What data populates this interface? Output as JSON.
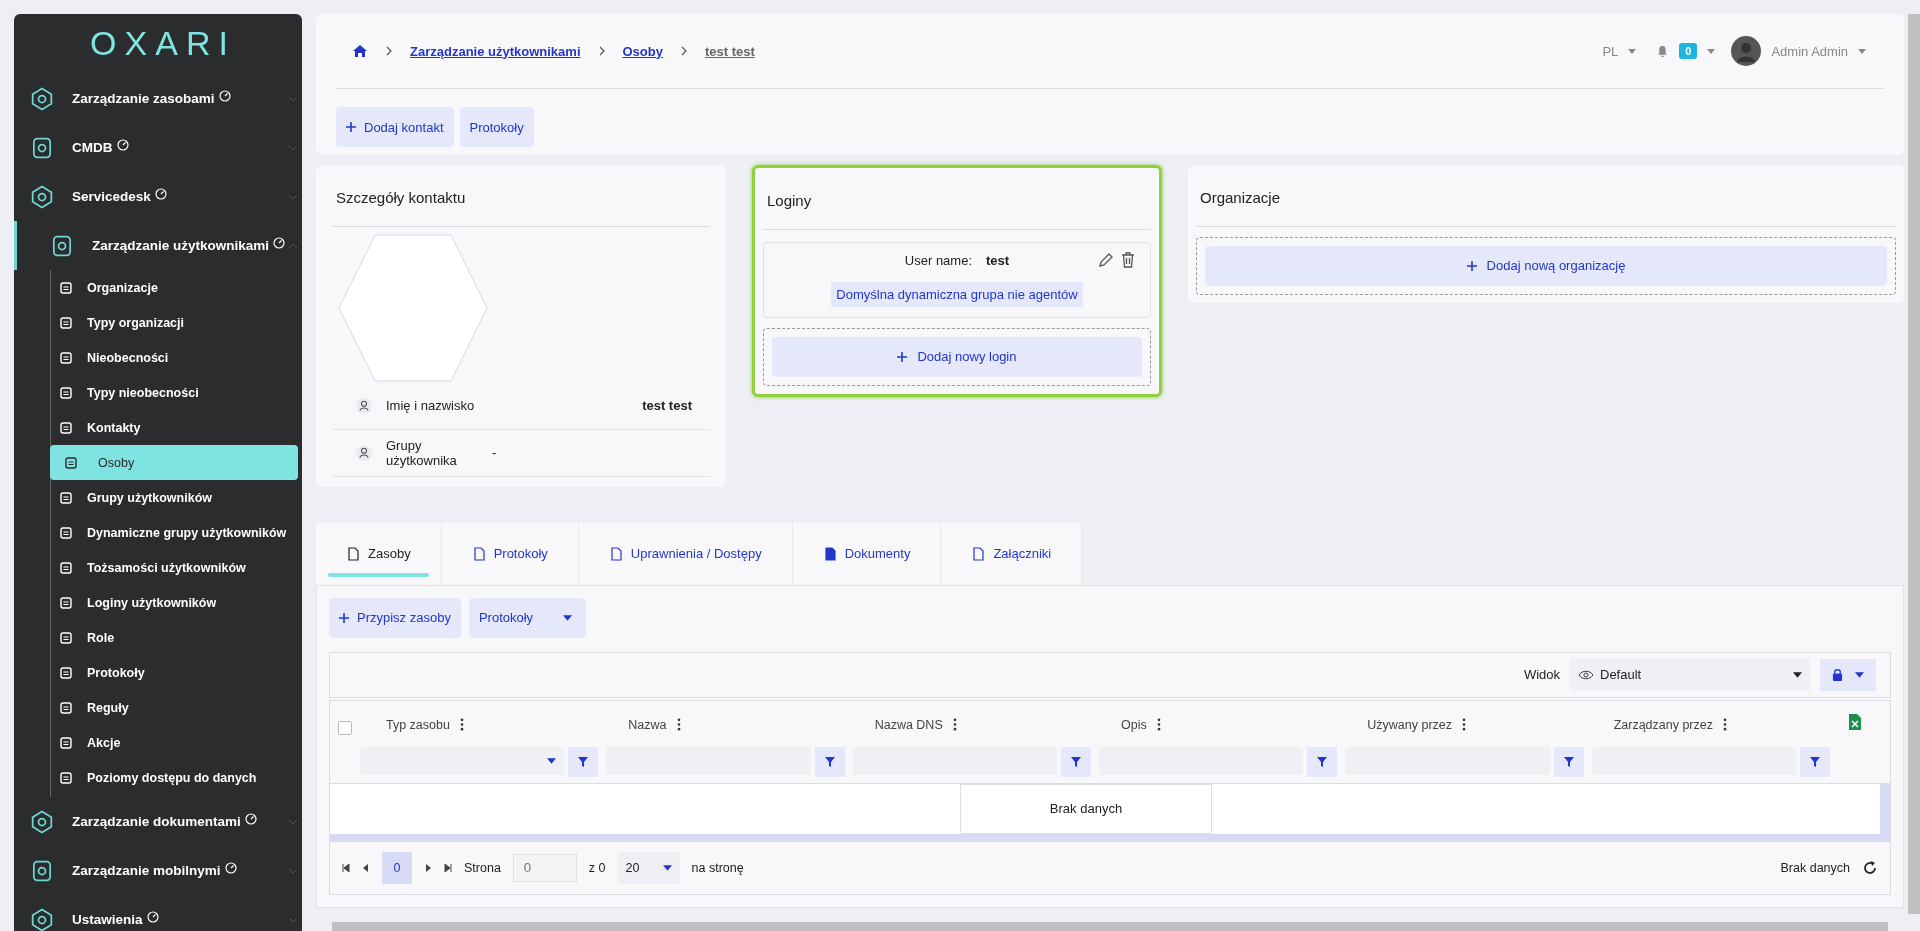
{
  "sidebar": {
    "logo": "OXARI",
    "items": [
      {
        "label": "Zarządzanie zasobami",
        "expanded": false
      },
      {
        "label": "CMDB",
        "expanded": false
      },
      {
        "label": "Servicedesk",
        "expanded": false
      },
      {
        "label": "Zarządzanie użytkownikami",
        "expanded": true,
        "children": [
          {
            "label": "Organizacje",
            "selected": false
          },
          {
            "label": "Typy organizacji",
            "selected": false
          },
          {
            "label": "Nieobecności",
            "selected": false
          },
          {
            "label": "Typy nieobecności",
            "selected": false
          },
          {
            "label": "Kontakty",
            "selected": false
          },
          {
            "label": "Osoby",
            "selected": true
          },
          {
            "label": "Grupy użytkowników",
            "selected": false
          },
          {
            "label": "Dynamiczne grupy użytkowników",
            "selected": false
          },
          {
            "label": "Tożsamości użytkowników",
            "selected": false
          },
          {
            "label": "Loginy użytkowników",
            "selected": false
          },
          {
            "label": "Role",
            "selected": false
          },
          {
            "label": "Protokoły",
            "selected": false
          },
          {
            "label": "Reguły",
            "selected": false
          },
          {
            "label": "Akcje",
            "selected": false
          },
          {
            "label": "Poziomy dostępu do danych",
            "selected": false
          }
        ]
      },
      {
        "label": "Zarządzanie dokumentami",
        "expanded": false
      },
      {
        "label": "Zarządzanie mobilnymi",
        "expanded": false
      },
      {
        "label": "Ustawienia",
        "expanded": false
      }
    ]
  },
  "breadcrumb": [
    "Zarządzanie użytkownikami",
    "Osoby",
    "test test"
  ],
  "header": {
    "language": "PL",
    "notifications": "0",
    "user": "Admin Admin"
  },
  "actions": [
    "Dodaj kontakt",
    "Protokoły"
  ],
  "contact": {
    "title": "Szczegóły kontaktu",
    "fields": [
      {
        "label": "Imię i nazwisko",
        "value": "test test"
      },
      {
        "label": "Grupy użytkownika",
        "value": "-"
      }
    ]
  },
  "logins": {
    "title": "Loginy",
    "highlighted": true,
    "entries": [
      {
        "label": "User name:",
        "value": "test",
        "group": "Domyślna dynamiczna grupa nie agentów"
      }
    ],
    "add": "Dodaj nowy login"
  },
  "organizations": {
    "title": "Organizacje",
    "add": "Dodaj nową organizację"
  },
  "tabs": [
    {
      "label": "Zasoby",
      "selected": true
    },
    {
      "label": "Protokoły",
      "selected": false
    },
    {
      "label": "Uprawnienia / Dostępy",
      "selected": false
    },
    {
      "label": "Dokumenty",
      "selected": false
    },
    {
      "label": "Załączniki",
      "selected": false
    }
  ],
  "toolbar": {
    "assign": "Przypisz zasoby",
    "protocols": "Protokoły"
  },
  "view": {
    "label": "Widok",
    "value": "Default"
  },
  "table": {
    "select_all_checked": false,
    "columns": [
      {
        "label": "Typ zasobu",
        "kind": "select"
      },
      {
        "label": "Nazwa",
        "kind": "text"
      },
      {
        "label": "Nazwa DNS",
        "kind": "text"
      },
      {
        "label": "Opis",
        "kind": "text"
      },
      {
        "label": "Używany przez",
        "kind": "text"
      },
      {
        "label": "Zarządzany przez",
        "kind": "text"
      }
    ],
    "empty": "Brak danych"
  },
  "pager": {
    "page": "0",
    "page_label": "Strona",
    "page_placeholder": "0",
    "of": "z 0",
    "size": "20",
    "per_page": "na stronę",
    "status": "Brak danych"
  }
}
